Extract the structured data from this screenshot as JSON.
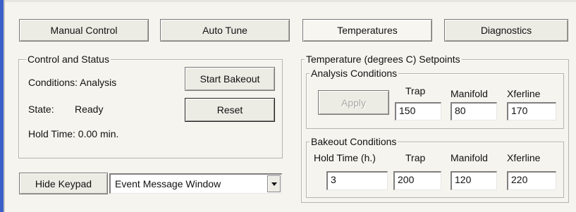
{
  "tabs": {
    "manual_control": "Manual Control",
    "auto_tune": "Auto Tune",
    "temperatures": "Temperatures",
    "diagnostics": "Diagnostics"
  },
  "control_status": {
    "legend": "Control and Status",
    "conditions_label": "Conditions: Analysis",
    "state_label": "State:",
    "state_value": "Ready",
    "hold_time_label": "Hold Time: 0.00 min.",
    "start_bakeout_label": "Start Bakeout",
    "reset_label": "Reset"
  },
  "bottom": {
    "hide_keypad_label": "Hide Keypad",
    "window_select_value": "Event Message Window"
  },
  "setpoints": {
    "legend": "Temperature (degrees C) Setpoints",
    "analysis": {
      "legend": "Analysis Conditions",
      "apply_label": "Apply",
      "col_trap": "Trap",
      "col_manifold": "Manifold",
      "col_xferline": "Xferline",
      "trap_value": "150",
      "manifold_value": "80",
      "xferline_value": "170"
    },
    "bakeout": {
      "legend": "Bakeout Conditions",
      "col_hold_time": "Hold Time (h.)",
      "col_trap": "Trap",
      "col_manifold": "Manifold",
      "col_xferline": "Xferline",
      "hold_time_value": "3",
      "trap_value": "200",
      "manifold_value": "120",
      "xferline_value": "220"
    }
  }
}
